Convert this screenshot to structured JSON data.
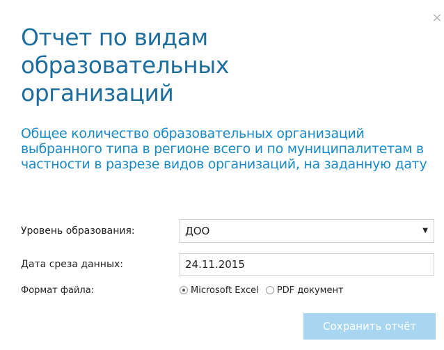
{
  "dialog": {
    "close_icon": "close-icon",
    "title": "Отчет по видам образовательных организаций",
    "description": "Общее количество образовательных организаций выбранного типа в регионе всего и по муниципалитетам в частности в разрезе видов организаций, на заданную дату"
  },
  "form": {
    "level": {
      "label": "Уровень образования:",
      "selected": "ДОО",
      "arrow_icon": "caret-down-icon"
    },
    "date": {
      "label": "Дата среза данных:",
      "value": "24.11.2015"
    },
    "format": {
      "label": "Формат файла:",
      "options": [
        {
          "label": "Microsoft Excel",
          "checked": true
        },
        {
          "label": "PDF документ",
          "checked": false
        }
      ]
    }
  },
  "actions": {
    "save_label": "Сохранить отчёт"
  },
  "colors": {
    "title": "#1d6e9c",
    "description": "#1a8ac6",
    "button": "#a8d5ef"
  }
}
